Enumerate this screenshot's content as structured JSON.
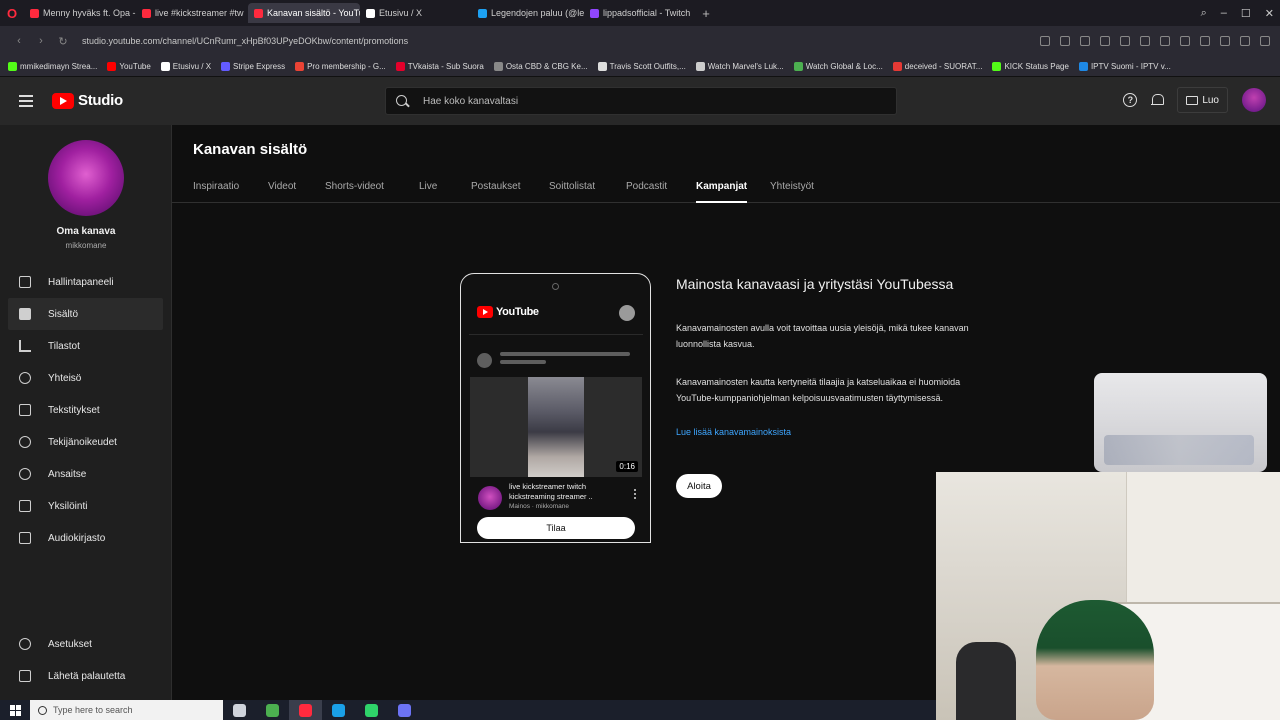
{
  "browser": {
    "tabs": [
      {
        "title": "Menny hyväks ft. Opa - Y",
        "fav_color": "#ff2a3e"
      },
      {
        "title": "live #kickstreamer #tw",
        "fav_color": "#ff2a3e"
      },
      {
        "title": "Kanavan sisältö - YouTub",
        "fav_color": "#ff2a3e",
        "active": true
      },
      {
        "title": "Etusivu / X",
        "fav_color": "#ffffff"
      },
      {
        "title": "Legendojen paluu (@lege",
        "fav_color": "#1da1f2"
      },
      {
        "title": "lippadsofficial - Twitch",
        "fav_color": "#9146ff"
      }
    ],
    "url": "studio.youtube.com/channel/UCnRumr_xHpBf03UPyeDOKbw/content/promotions",
    "bookmarks": [
      {
        "label": "mmikedimayn Strea...",
        "color": "#53fc18"
      },
      {
        "label": "YouTube",
        "color": "#ff0000"
      },
      {
        "label": "Etusivu / X",
        "color": "#ffffff"
      },
      {
        "label": "Stripe Express",
        "color": "#635bff"
      },
      {
        "label": "Pro membership - G...",
        "color": "#ea4335"
      },
      {
        "label": "TVkaista - Sub Suora",
        "color": "#e4002b"
      },
      {
        "label": "Osta CBD & CBG Ke...",
        "color": "#888888"
      },
      {
        "label": "Travis Scott Outfits,...",
        "color": "#dddddd"
      },
      {
        "label": "Watch Marvel's Luk...",
        "color": "#cccccc"
      },
      {
        "label": "Watch Global & Loc...",
        "color": "#4caf50"
      },
      {
        "label": "deceived - SUORAT...",
        "color": "#e53935"
      },
      {
        "label": "KICK Status Page",
        "color": "#53fc18"
      },
      {
        "label": "IPTV Suomi - IPTV v...",
        "color": "#1e88e5"
      }
    ]
  },
  "header": {
    "logo_text": "Studio",
    "search_placeholder": "Hae koko kanavaltasi",
    "help_glyph": "?",
    "create_label": "Luo"
  },
  "sidebar": {
    "channel_title": "Oma kanava",
    "channel_handle": "mikkomane",
    "items": [
      {
        "label": "Hallintapaneeli",
        "icon": "dashboard-icon"
      },
      {
        "label": "Sisältö",
        "icon": "content-icon",
        "active": true
      },
      {
        "label": "Tilastot",
        "icon": "analytics-icon"
      },
      {
        "label": "Yhteisö",
        "icon": "community-icon"
      },
      {
        "label": "Tekstitykset",
        "icon": "subtitles-icon"
      },
      {
        "label": "Tekijänoikeudet",
        "icon": "copyright-icon"
      },
      {
        "label": "Ansaitse",
        "icon": "earn-icon"
      },
      {
        "label": "Yksilöinti",
        "icon": "customization-icon"
      },
      {
        "label": "Audiokirjasto",
        "icon": "audio-library-icon"
      }
    ],
    "bottom_items": [
      {
        "label": "Asetukset",
        "icon": "settings-icon"
      },
      {
        "label": "Lähetä palautetta",
        "icon": "feedback-icon"
      }
    ]
  },
  "main": {
    "title": "Kanavan sisältö",
    "tabs": [
      {
        "label": "Inspiraatio"
      },
      {
        "label": "Videot"
      },
      {
        "label": "Shorts-videot"
      },
      {
        "label": "Live"
      },
      {
        "label": "Postaukset"
      },
      {
        "label": "Soittolistat"
      },
      {
        "label": "Podcastit"
      },
      {
        "label": "Kampanjat",
        "active": true
      },
      {
        "label": "Yhteistyöt"
      }
    ],
    "promo": {
      "heading": "Mainosta kanavaasi ja yritystäsi YouTubessa",
      "paragraph1": "Kanavamainosten avulla voit tavoittaa uusia yleisöjä, mikä tukee kanavan luonnollista kasvua.",
      "paragraph2": "Kanavamainosten kautta kertyneitä tilaajia ja katseluaikaa ei huomioida YouTube-kumppaniohjelman kelpoisuusvaatimusten täyttymisessä.",
      "learn_more": "Lue lisää kanavamainoksista",
      "start_label": "Aloita"
    },
    "phone": {
      "logo_text": "YouTube",
      "duration": "0:16",
      "video_title": "live kickstreamer twitch kickstreaming streamer ..",
      "video_sub": "Mainos · mikkomane",
      "subscribe_label": "Tilaa"
    }
  },
  "taskbar": {
    "search_placeholder": "Type here to search",
    "apps": [
      {
        "name": "task-view",
        "color": "#cfd3dc"
      },
      {
        "name": "chrome",
        "color": "#4caf50"
      },
      {
        "name": "opera",
        "color": "#ff2a3e",
        "active": true
      },
      {
        "name": "edge",
        "color": "#1aa0e8"
      },
      {
        "name": "app-green",
        "color": "#2fd36a"
      },
      {
        "name": "discord",
        "color": "#6c73f5"
      }
    ]
  }
}
